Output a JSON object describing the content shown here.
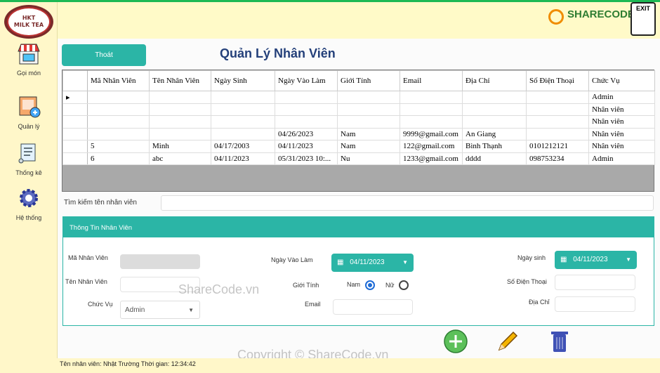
{
  "app": {
    "logo": {
      "line1": "HKT",
      "line2": "MILK TEA"
    },
    "brand": "SHARECODE.vn",
    "exit_label": "EXIT"
  },
  "sidebar": {
    "items": [
      {
        "label": "Gọi món",
        "icon": "shop-icon"
      },
      {
        "label": "Quản lý",
        "icon": "edit-doc-icon"
      },
      {
        "label": "Thống kê",
        "icon": "scroll-icon"
      },
      {
        "label": "Hệ thống",
        "icon": "gear-icon"
      }
    ]
  },
  "header": {
    "thoat_label": "Thoát",
    "title": "Quản Lý Nhân Viên"
  },
  "grid": {
    "columns": [
      "Mã Nhân Viên",
      "Tên Nhân Viên",
      "Ngày Sinh",
      "Ngày Vào Làm",
      "Giới Tính",
      "Email",
      "Địa Chỉ",
      "Số Điện Thoại",
      "Chức Vụ"
    ],
    "rows": [
      [
        "",
        "",
        "",
        "",
        "",
        "",
        "",
        "",
        "Admin"
      ],
      [
        "",
        "",
        "",
        "",
        "",
        "",
        "",
        "",
        "Nhân viên"
      ],
      [
        "",
        "",
        "",
        "",
        "",
        "",
        "",
        "",
        "Nhân viên"
      ],
      [
        "",
        "",
        "",
        "04/26/2023",
        "Nam",
        "9999@gmail.com",
        "An Giang",
        "",
        "Nhân viên"
      ],
      [
        "5",
        "Minh",
        "04/17/2003",
        "04/11/2023",
        "Nam",
        "122@gmail.com",
        "Bình Thạnh",
        "0101212121",
        "Nhân viên"
      ],
      [
        "6",
        "abc",
        "04/11/2023",
        "05/31/2023 10:...",
        "Nu",
        "1233@gmail.com",
        "dddd",
        "098753234",
        "Admin"
      ]
    ]
  },
  "search": {
    "label": "Tìm kiếm tên nhân viên",
    "value": ""
  },
  "info": {
    "header": "Thông Tin Nhân Viên",
    "ma_label": "Mã Nhân Viên",
    "ten_label": "Tên Nhân Viên",
    "chucvu_label": "Chức Vụ",
    "chucvu_value": "Admin",
    "ngayvao_label": "Ngày Vào Làm",
    "ngayvao_value": "04/11/2023",
    "gioitinh_label": "Giới Tính",
    "nam_label": "Nam",
    "nu_label": "Nữ",
    "email_label": "Email",
    "ngaysinh_label": "Ngày sinh",
    "ngaysinh_value": "04/11/2023",
    "sdt_label": "Số Điện Thoại",
    "diachi_label": "Địa Chỉ"
  },
  "watermarks": {
    "center": "ShareCode.vn",
    "bottom": "Copyright © ShareCode.vn"
  },
  "status": {
    "text": "Tên nhân viên: Nhật Trường  Thời gian: 12:34:42"
  },
  "colors": {
    "accent": "#2bb5a6",
    "sidebar": "#fff7c9",
    "title": "#24407a"
  }
}
